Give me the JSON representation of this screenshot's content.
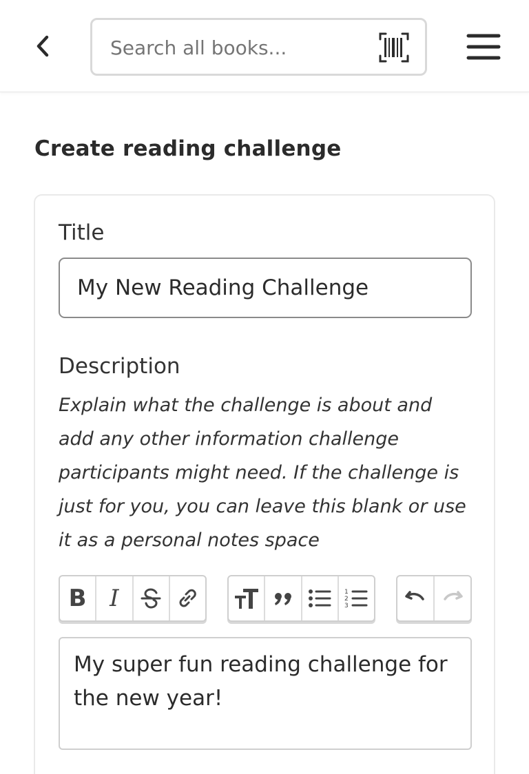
{
  "header": {
    "back_icon": "chevron-left-icon",
    "search": {
      "placeholder": "Search all books...",
      "value": ""
    },
    "barcode_icon": "barcode-scan-icon",
    "menu_icon": "hamburger-menu-icon"
  },
  "page": {
    "title": "Create reading challenge"
  },
  "form": {
    "title_label": "Title",
    "title_value": "My New Reading Challenge",
    "description_label": "Description",
    "description_help": "Explain what the challenge is about and add any other information challenge participants might need. If the challenge is just for you, you can leave this blank or use it as a personal notes space",
    "toolbar": {
      "bold": "B",
      "italic": "I",
      "strikethrough_icon": "strikethrough-icon",
      "link_icon": "link-icon",
      "heading_icon": "heading-icon",
      "quote_icon": "quote-icon",
      "bullet_list_icon": "bullet-list-icon",
      "numbered_list_icon": "numbered-list-icon",
      "undo_icon": "undo-icon",
      "redo_icon": "redo-icon"
    },
    "description_value": "My super fun reading challenge for the new year!"
  },
  "colors": {
    "text": "#2b2b2b",
    "border": "#cfcfcf",
    "input_border": "#8a8a8a",
    "disabled_icon": "#c8c8c8"
  }
}
